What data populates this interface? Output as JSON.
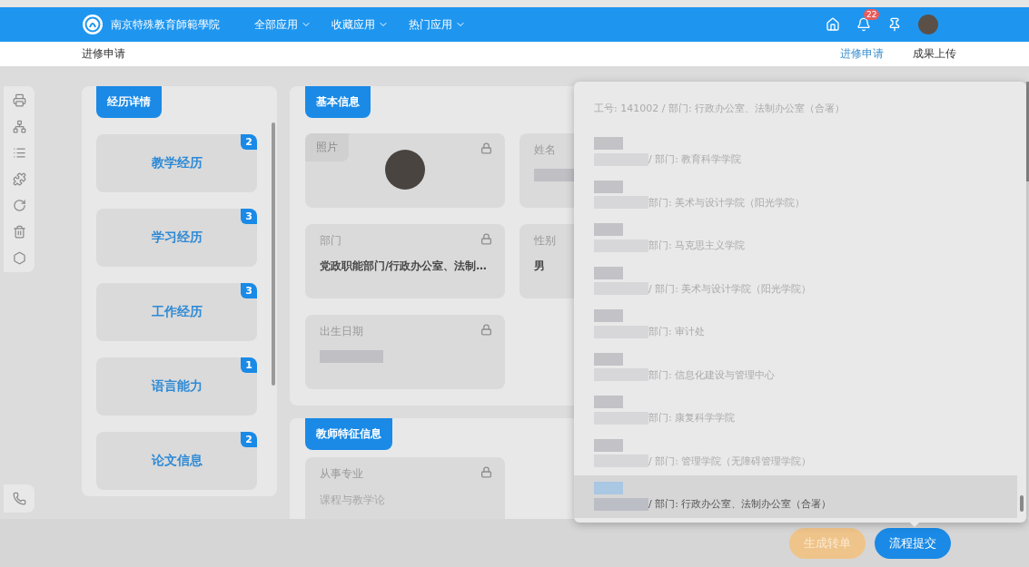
{
  "header": {
    "logo_text": "南京特殊教育師範學院",
    "nav": [
      {
        "label": "全部应用"
      },
      {
        "label": "收藏应用"
      },
      {
        "label": "热门应用"
      }
    ],
    "notifications": "22"
  },
  "subbar": {
    "title": "进修申请",
    "tabs": [
      {
        "label": "进修申请",
        "selected": true
      },
      {
        "label": "成果上传",
        "selected": false
      }
    ]
  },
  "experience": {
    "title": "经历详情",
    "items": [
      {
        "label": "教学经历",
        "count": "2"
      },
      {
        "label": "学习经历",
        "count": "3"
      },
      {
        "label": "工作经历",
        "count": "3"
      },
      {
        "label": "语言能力",
        "count": "1"
      },
      {
        "label": "论文信息",
        "count": "2"
      }
    ]
  },
  "basic_info": {
    "title": "基本信息",
    "fields": [
      {
        "label": "照片",
        "kind": "photo",
        "locked": true
      },
      {
        "label": "姓名",
        "kind": "redacted"
      },
      {
        "label": "部门",
        "kind": "text",
        "value": "党政职能部门/行政办公室、法制…",
        "locked": true
      },
      {
        "label": "性别",
        "kind": "text",
        "value": "男"
      },
      {
        "label": "出生日期",
        "kind": "redacted",
        "locked": true
      }
    ]
  },
  "teacher_info": {
    "title": "教师特征信息",
    "fields": [
      {
        "label": "从事专业",
        "kind": "faded",
        "value": "课程与教学论",
        "locked": true
      }
    ]
  },
  "user_picker": {
    "options": [
      {
        "kind": "partial",
        "text": "工号: 141002 / 部门: 行政办公室、法制办公室（合署）",
        "selected": false
      },
      {
        "kind": "redacted",
        "text": "/ 部门: 教育科学学院",
        "selected": false
      },
      {
        "kind": "redacted",
        "text": "部门: 美术与设计学院（阳光学院）",
        "selected": false
      },
      {
        "kind": "redacted",
        "text": "部门: 马克思主义学院",
        "selected": false
      },
      {
        "kind": "redacted",
        "text": "/ 部门: 美术与设计学院（阳光学院）",
        "selected": false
      },
      {
        "kind": "redacted",
        "text": "部门: 审计处",
        "selected": false
      },
      {
        "kind": "redacted",
        "text": "部门: 信息化建设与管理中心",
        "selected": false
      },
      {
        "kind": "redacted",
        "text": "部门: 康复科学学院",
        "selected": false
      },
      {
        "kind": "redacted",
        "text": "/ 部门: 管理学院（无障碍管理学院）",
        "selected": false
      },
      {
        "kind": "redacted",
        "text": "/ 部门: 行政办公室、法制办公室（合署）",
        "selected": true
      }
    ]
  },
  "actions": [
    {
      "label": "生成转单",
      "kind": "secondary"
    },
    {
      "label": "流程提交",
      "kind": "primary"
    }
  ]
}
